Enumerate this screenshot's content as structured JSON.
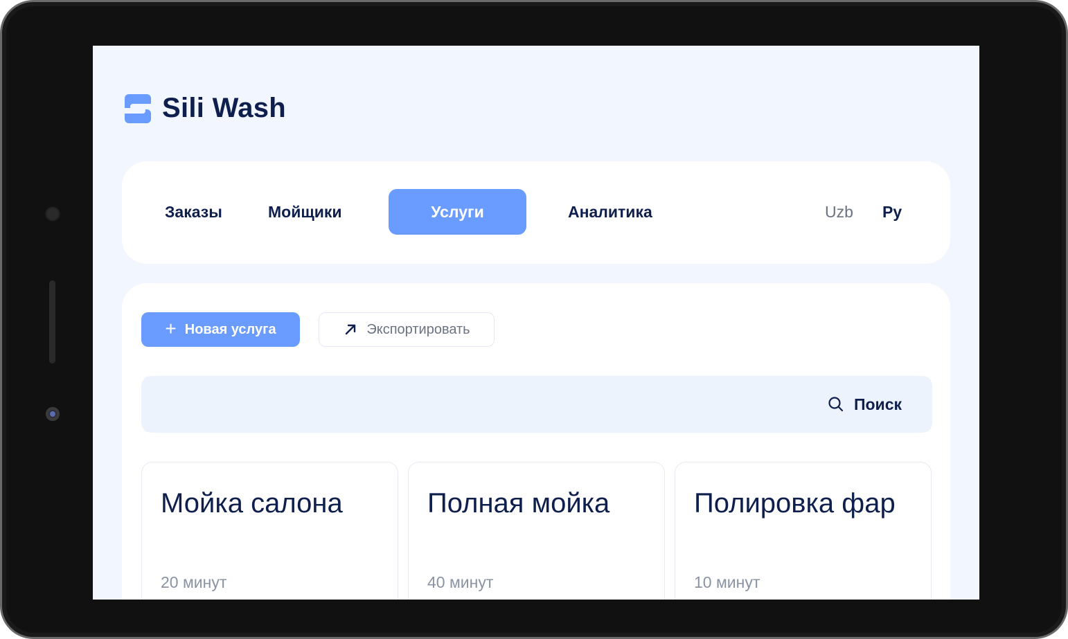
{
  "app": {
    "name": "Sili Wash"
  },
  "nav": {
    "items": [
      {
        "label": "Заказы",
        "active": false
      },
      {
        "label": "Мойщики",
        "active": false
      },
      {
        "label": "Услуги",
        "active": true
      },
      {
        "label": "Аналитика",
        "active": false
      }
    ],
    "languages": [
      {
        "label": "Uzb",
        "active": false
      },
      {
        "label": "Ру",
        "active": true
      }
    ]
  },
  "toolbar": {
    "new_label": "Новая услуга",
    "export_label": "Экспортировать"
  },
  "search": {
    "label": "Поиск",
    "value": ""
  },
  "services": [
    {
      "title": "Мойка салона",
      "duration": "20 минут"
    },
    {
      "title": "Полная мойка",
      "duration": "40 минут"
    },
    {
      "title": "Полировка фар",
      "duration": "10 минут"
    }
  ],
  "colors": {
    "accent": "#6a9cff",
    "text_primary": "#0f1f4d",
    "text_muted": "#8a93a3",
    "screen_bg": "#f2f7ff"
  }
}
